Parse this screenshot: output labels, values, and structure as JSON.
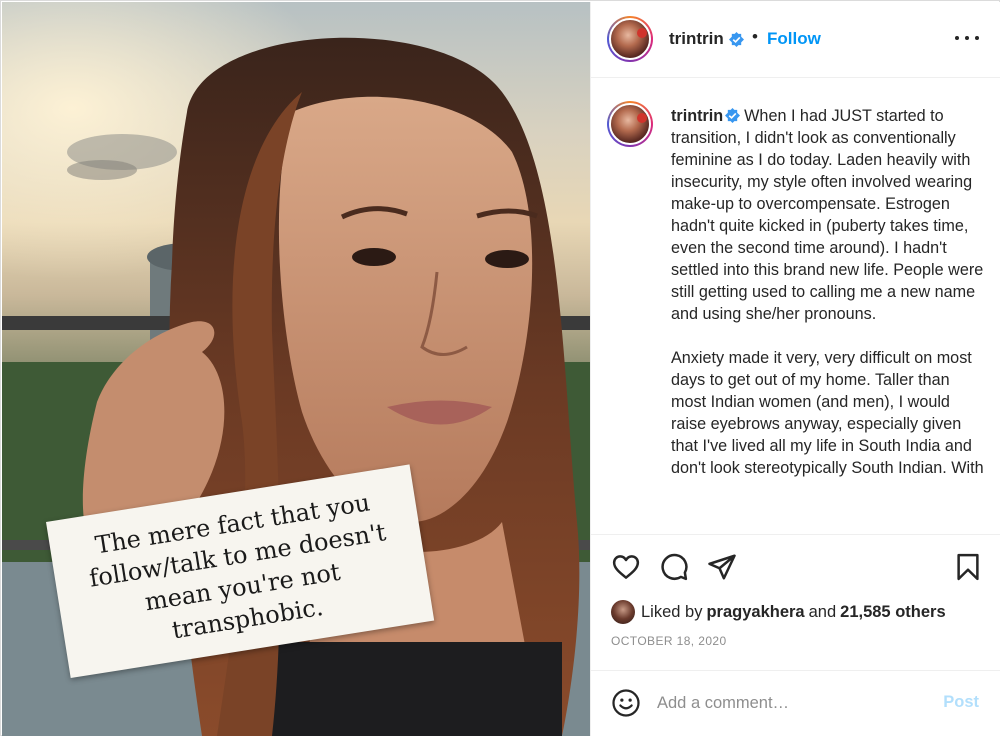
{
  "post": {
    "username": "trintrin",
    "follow_label": "Follow",
    "separator": "•",
    "image_quote": "The mere fact that you\nfollow/talk to me doesn't\nmean you're not transphobic.",
    "caption_paragraphs": [
      "When I had JUST started to transition, I didn't look as conventionally feminine as I do today. Laden heavily with insecurity, my style often involved wearing make-up to overcompensate. Estrogen hadn't quite kicked in (puberty takes time, even the second time around). I hadn't settled into this brand new life. People were still getting used to calling me a new name and using she/her pronouns.",
      "Anxiety made it very, very difficult on most days to get out of my home. Taller than most Indian women (and men), I would raise eyebrows anyway, especially given that I've lived all my life in South India and don't look stereotypically South Indian. With"
    ],
    "likes": {
      "prefix": "Liked by",
      "liker": "pragyakhera",
      "connector": "and",
      "others": "21,585 others"
    },
    "date": "OCTOBER 18, 2020",
    "comment": {
      "placeholder": "Add a comment…",
      "value": "",
      "post_label": "Post"
    }
  },
  "icons": {
    "verified": "verified-badge-icon",
    "more": "more-options-icon",
    "like": "heart-icon",
    "comment": "comment-bubble-icon",
    "share": "paper-plane-icon",
    "save": "bookmark-icon",
    "emoji": "smiley-icon"
  },
  "colors": {
    "link_blue": "#0095f6",
    "post_disabled": "#b2dffc",
    "verified_blue": "#3897f0",
    "muted": "#8e8e8e",
    "text": "#262626"
  }
}
